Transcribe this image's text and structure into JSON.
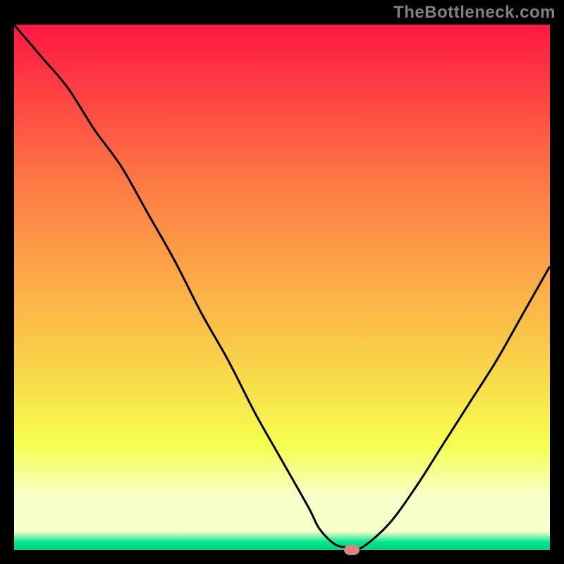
{
  "attribution": "TheBottleneck.com",
  "colors": {
    "gradient_top": "#fd1841",
    "gradient_band_1": "#fe3e43",
    "gradient_mid_1": "#fd7945",
    "gradient_mid_2": "#fbae47",
    "gradient_mid_3": "#f8dc4a",
    "gradient_yellow": "#f4ff4f",
    "gradient_pale": "#f9ffc9",
    "gradient_green": "#00e891",
    "gradient_deep": "#00d186",
    "curve": "#000000",
    "marker": "#e0827e",
    "background": "#000000"
  },
  "chart_data": {
    "type": "line",
    "title": "",
    "xlabel": "",
    "ylabel": "",
    "xlim": [
      0,
      100
    ],
    "ylim": [
      0,
      100
    ],
    "grid": false,
    "gradient_background": true,
    "series": [
      {
        "name": "bottleneck-curve",
        "x": [
          0,
          5,
          10,
          15,
          20,
          25,
          30,
          35,
          40,
          45,
          50,
          55,
          57,
          60,
          63,
          65,
          70,
          75,
          80,
          85,
          90,
          95,
          100
        ],
        "values": [
          100,
          94,
          88,
          80,
          73,
          64,
          55,
          45,
          36,
          26,
          17,
          8,
          4,
          1,
          0.5,
          0.5,
          5,
          12,
          20,
          28,
          36,
          45,
          54
        ]
      }
    ],
    "marker": {
      "x": 63,
      "y": 0
    },
    "annotations": []
  }
}
